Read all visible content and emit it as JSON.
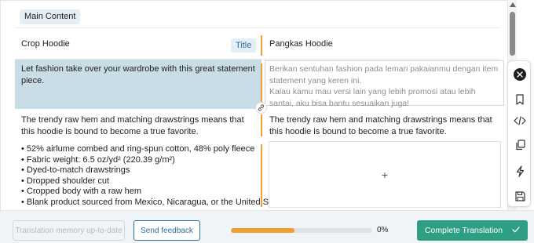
{
  "section_label": "Main Content",
  "title_row": {
    "source": "Crop Hoodie",
    "badge": "Title",
    "target": "Pangkas Hoodie"
  },
  "active_row": {
    "source": "Let fashion take over your wardrobe with this great statement piece.",
    "target_placeholder": "Berikan sentuhan fashion pada lemari pakaianmu dengan item statement yang keren ini.\nKalau kamu mau versi lain yang lebih promosi atau lebih santai, aku bisa bantu sesuaikan juga!"
  },
  "description_row": {
    "source": "The trendy raw hem and matching drawstrings means that this hoodie is bound to become a true favorite.",
    "target": "The trendy raw hem and matching drawstrings means that this hoodie is bound to become a true favorite."
  },
  "bullets": [
    "• 52% airlume combed and ring-spun cotton, 48% poly fleece",
    "• Fabric weight: 6.5 oz/yd² (220.39 g/m²)",
    "• Dyed-to-match drawstrings",
    "• Dropped shoulder cut",
    "• Cropped body with a raw hem",
    "• Blank product sourced from Mexico, Nicaragua, or the United States"
  ],
  "add_box_symbol": "+",
  "toolbar_icons": [
    "close-icon",
    "bookmark-icon",
    "code-icon",
    "copy-icon",
    "lightning-icon",
    "save-icon"
  ],
  "footer": {
    "memory_button": "Translation memory up-to-date",
    "feedback_button": "Send feedback",
    "progress_percent": 0.45,
    "progress_label": "0%",
    "complete_button": "Complete Translation"
  },
  "colors": {
    "accent_orange": "#f0a030",
    "active_row_bg": "#c9dde7",
    "primary_blue": "#2c6fa1",
    "complete_green": "#2e9e85"
  }
}
